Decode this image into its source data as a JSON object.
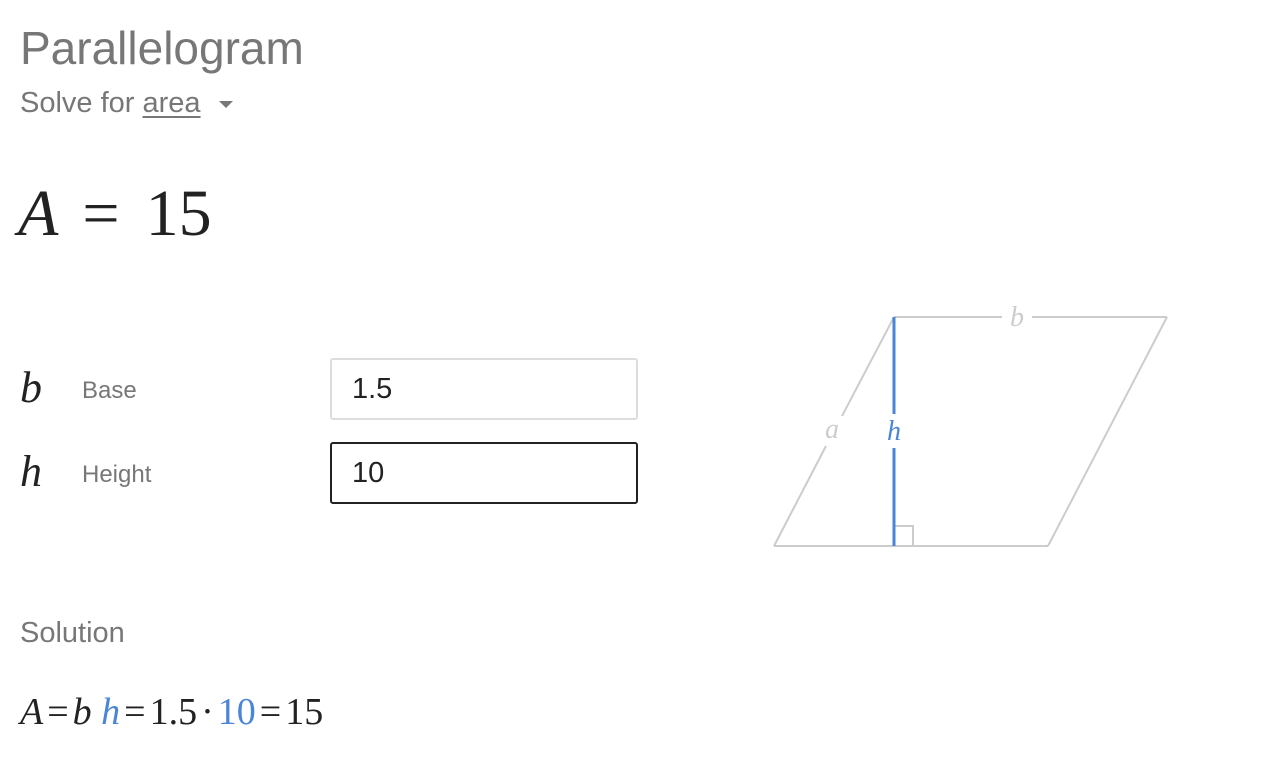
{
  "title": "Parallelogram",
  "solve_for": {
    "prefix": "Solve for",
    "variable": "area"
  },
  "result": {
    "symbol": "A",
    "equals": "=",
    "value": "15"
  },
  "variables": [
    {
      "symbol": "b",
      "label": "Base",
      "value": "1.5",
      "focused": false
    },
    {
      "symbol": "h",
      "label": "Height",
      "value": "10",
      "focused": true
    }
  ],
  "diagram": {
    "label_a": "a",
    "label_b": "b",
    "label_h": "h"
  },
  "solution": {
    "label": "Solution",
    "expr": {
      "A": "A",
      "eq1": "=",
      "b": "b",
      "h": "h",
      "eq2": "=",
      "b_val": "1.5",
      "dot": "·",
      "h_val": "10",
      "eq3": "=",
      "result": "15"
    }
  },
  "colors": {
    "accent": "#4a85d8",
    "muted": "#777777",
    "diagram_line": "#cccccc"
  }
}
